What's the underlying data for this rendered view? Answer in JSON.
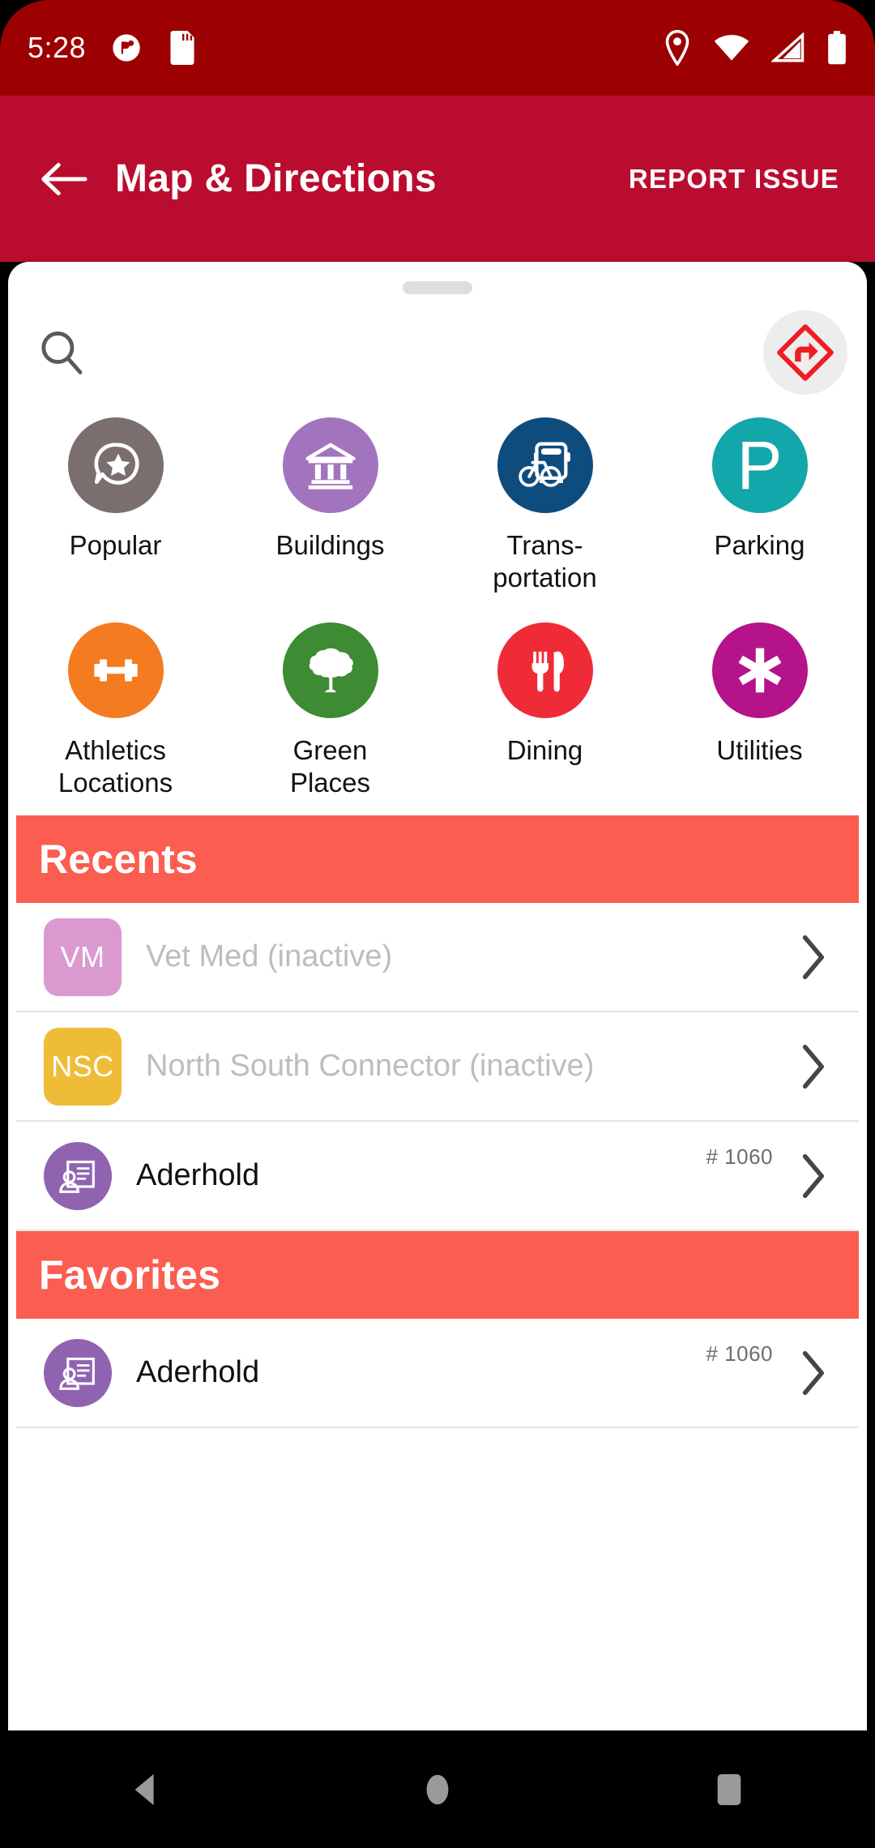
{
  "status_bar": {
    "time": "5:28",
    "icons": [
      "notification-icon",
      "sd-card-icon",
      "location-icon",
      "wifi-icon",
      "cellular-signal-icon",
      "battery-icon"
    ],
    "background": "#9C0000"
  },
  "app_bar": {
    "back_icon": "back-arrow-icon",
    "title": "Map & Directions",
    "action_label": "REPORT ISSUE",
    "background": "#BA0C2F"
  },
  "sheet": {
    "grabber": "drag-handle",
    "search_icon": "search-icon",
    "directions_icon": "directions-diamond-icon"
  },
  "categories": [
    {
      "label": "Popular",
      "icon": "speech-bubble-star-icon",
      "color": "#7A6E6E"
    },
    {
      "label": "Buildings",
      "icon": "bank-building-icon",
      "color": "#A274BE"
    },
    {
      "label": "Trans-\nportation",
      "icon": "bus-bike-icon",
      "color": "#0E4C7E"
    },
    {
      "label": "Parking",
      "icon": "parking-p-icon",
      "color": "#13A6AA"
    },
    {
      "label": "Athletics\nLocations",
      "icon": "dumbbell-icon",
      "color": "#F47B20"
    },
    {
      "label": "Green\nPlaces",
      "icon": "tree-icon",
      "color": "#3D8B33"
    },
    {
      "label": "Dining",
      "icon": "fork-knife-icon",
      "color": "#EE2B37"
    },
    {
      "label": "Utilities",
      "icon": "asterisk-icon",
      "color": "#B5138A"
    }
  ],
  "recents": {
    "header": "Recents",
    "header_color": "#FB5D50",
    "items": [
      {
        "badge_text": "VM",
        "badge_color": "#DA9AD0",
        "label": "Vet Med (inactive)",
        "inactive": true,
        "number": ""
      },
      {
        "badge_text": "NSC",
        "badge_color": "#EFBC38",
        "label": "North South Connector (inactive)",
        "inactive": true,
        "number": ""
      },
      {
        "badge_text": "",
        "badge_color": "#9063B0",
        "label": "Aderhold",
        "inactive": false,
        "number": "# 1060",
        "icon": "id-card-person-icon"
      }
    ]
  },
  "favorites": {
    "header": "Favorites",
    "header_color": "#FB5D50",
    "items": [
      {
        "badge_text": "",
        "badge_color": "#9063B0",
        "label": "Aderhold",
        "inactive": false,
        "number": "# 1060",
        "icon": "id-card-person-icon"
      }
    ]
  },
  "nav_bar": {
    "back": "nav-back-triangle-icon",
    "home": "nav-home-circle-icon",
    "recents": "nav-recents-square-icon"
  }
}
